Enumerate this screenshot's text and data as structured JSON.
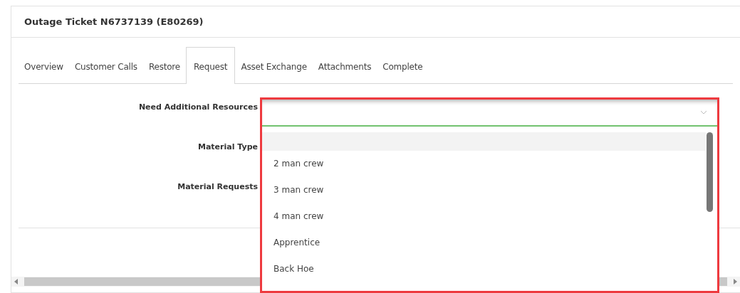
{
  "panel": {
    "title": "Outage Ticket N6737139 (E80269)"
  },
  "tabs": [
    {
      "label": "Overview",
      "selected": false
    },
    {
      "label": "Customer Calls",
      "selected": false
    },
    {
      "label": "Restore",
      "selected": false
    },
    {
      "label": "Request",
      "selected": true
    },
    {
      "label": "Asset Exchange",
      "selected": false
    },
    {
      "label": "Attachments",
      "selected": false
    },
    {
      "label": "Complete",
      "selected": false
    }
  ],
  "form": {
    "labels": [
      "Need Additional Resources",
      "Material Type",
      "Material Requests"
    ]
  },
  "dropdown": {
    "expanded": true,
    "blank_option_highlighted": true,
    "options": [
      {
        "label": "2 man crew",
        "selected": false
      },
      {
        "label": "3 man crew",
        "selected": false
      },
      {
        "label": "4 man crew",
        "selected": false
      },
      {
        "label": "Apprentice",
        "selected": false
      },
      {
        "label": "Back Hoe",
        "selected": false
      }
    ]
  }
}
